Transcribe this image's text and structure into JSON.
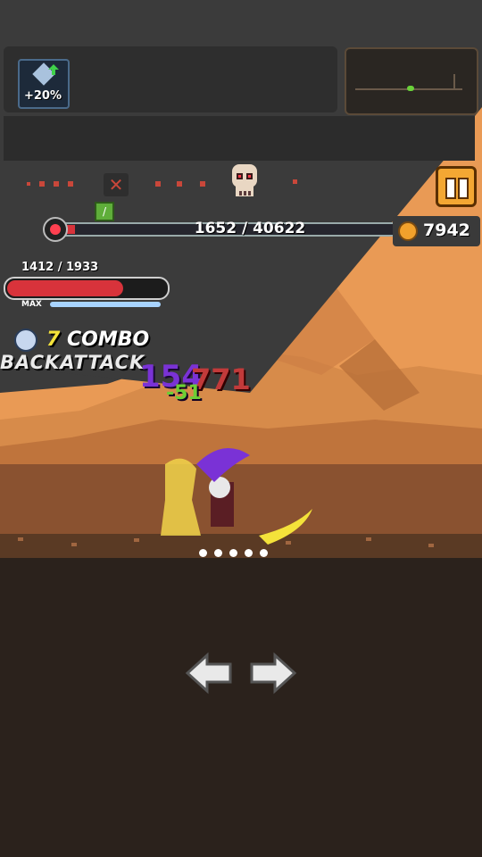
{
  "buff": {
    "icon": "sword-upgrade-icon",
    "label": "+20%"
  },
  "pause_button": {
    "icon": "pause-icon"
  },
  "boss": {
    "icon": "skull-icon",
    "hp_text": "1652 / 40622",
    "hp_fraction": 0.04
  },
  "coins": {
    "icon": "coin-icon",
    "value": "7942"
  },
  "player": {
    "hp_text": "1412 / 1933",
    "hp_fraction": 0.73,
    "max_label": "MAX",
    "mp_fraction": 1.0
  },
  "combo": {
    "count": "7",
    "label": "COMBO",
    "skill": "BACKATTACK"
  },
  "damage": {
    "purple": "154",
    "red": "771",
    "green": "-51"
  },
  "stage_progress": {
    "icons": [
      "close-icon",
      "skull-icon"
    ]
  },
  "controls": {
    "left": "left-arrow-icon",
    "right": "right-arrow-icon"
  },
  "dots": [
    1,
    1,
    1,
    1,
    1
  ]
}
